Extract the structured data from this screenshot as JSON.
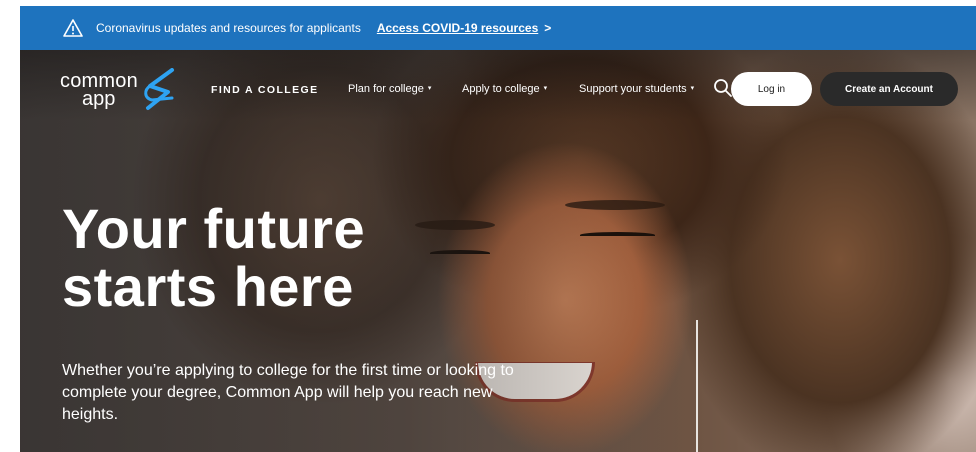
{
  "banner": {
    "message": "Coronavirus updates and resources for applicants",
    "link_label": "Access COVID-19 resources",
    "link_chevron": ">",
    "icon": "warning-triangle-icon",
    "background": "#1e73be"
  },
  "logo": {
    "line1": "common",
    "line2": "app",
    "accent": "#2ea3f2"
  },
  "nav": {
    "find_college": "FIND A COLLEGE",
    "plan": "Plan for college",
    "apply": "Apply to college",
    "support": "Support your students",
    "caret": "▾"
  },
  "buttons": {
    "login": "Log in",
    "create_account": "Create an Account"
  },
  "hero": {
    "headline_line1": "Your future",
    "headline_line2": "starts here",
    "subtext": "Whether you’re applying to college for the first time or looking to complete your degree, Common App will help you reach new heights."
  }
}
